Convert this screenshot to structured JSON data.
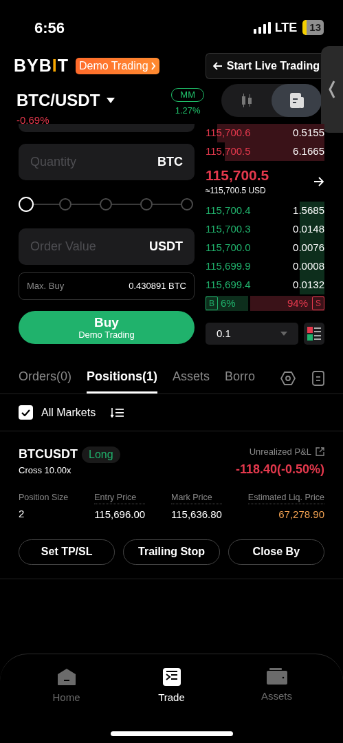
{
  "status_bar": {
    "time": "6:56",
    "network": "LTE",
    "battery": "13"
  },
  "header": {
    "logo": "BYBIT",
    "demo_badge": "Demo Trading",
    "live_button": "Start Live Trading"
  },
  "pair": {
    "symbol": "BTC/USDT",
    "change": "-0.69%",
    "mm_label": "MM",
    "mm_rate": "1.27%"
  },
  "view_toggle": [
    {
      "kind": "chart",
      "selected": false
    },
    {
      "kind": "orderbook",
      "selected": true
    }
  ],
  "order_form": {
    "quantity": {
      "placeholder": "Quantity",
      "unit": "BTC"
    },
    "slider": {
      "level": 0
    },
    "order_value": {
      "placeholder": "Order Value",
      "unit": "USDT"
    },
    "max_buy": {
      "label": "Max. Buy",
      "value": "0.430891 BTC"
    },
    "buy_button": {
      "title": "Buy",
      "subtitle": "Demo Trading"
    }
  },
  "orderbook": {
    "asks": [
      {
        "price": "115,700.6",
        "size": "0.5155",
        "level": 0.9
      },
      {
        "price": "115,700.5",
        "size": "6.1665",
        "level": 0.84
      }
    ],
    "mid_price": "115,700.5",
    "mid_usd": "≈115,700.5 USD",
    "bids": [
      {
        "price": "115,700.4",
        "size": "1.5685",
        "level": 0.21
      },
      {
        "price": "115,700.3",
        "size": "0.0148",
        "level": 0.21
      },
      {
        "price": "115,700.0",
        "size": "0.0076",
        "level": 0.21
      },
      {
        "price": "115,699.9",
        "size": "0.0008",
        "level": 0.21
      },
      {
        "price": "115,699.4",
        "size": "0.0132",
        "level": 0.21
      }
    ],
    "ratio": {
      "buy_label": "B",
      "buy": "6%",
      "sell": "94%",
      "sell_label": "S"
    },
    "precision": "0.1"
  },
  "tabs": [
    {
      "label": "Orders(0)",
      "selected": false
    },
    {
      "label": "Positions(1)",
      "selected": true
    },
    {
      "label": "Assets",
      "selected": false
    },
    {
      "label": "Borro",
      "selected": false
    }
  ],
  "filter": {
    "label": "All Markets",
    "checked": true
  },
  "position": {
    "symbol": "BTCUSDT",
    "side": "Long",
    "margin": "Cross 10.00x",
    "pnl_label": "Unrealized P&L",
    "pnl": "-118.40(-0.50%)",
    "fields": [
      {
        "label": "Position Size",
        "value": "2",
        "kind": "plain"
      },
      {
        "label": "Entry Price",
        "value": "115,696.00",
        "kind": "plain"
      },
      {
        "label": "Mark Price",
        "value": "115,636.80",
        "kind": "plain"
      },
      {
        "label": "Estimated Liq. Price",
        "value": "67,278.90",
        "kind": "warning"
      }
    ],
    "buttons": [
      "Set TP/SL",
      "Trailing Stop",
      "Close By"
    ]
  },
  "nav": [
    {
      "label": "Home",
      "kind": "home",
      "selected": false
    },
    {
      "label": "Trade",
      "kind": "trade",
      "selected": true
    },
    {
      "label": "Assets",
      "kind": "wallet",
      "selected": false
    }
  ]
}
